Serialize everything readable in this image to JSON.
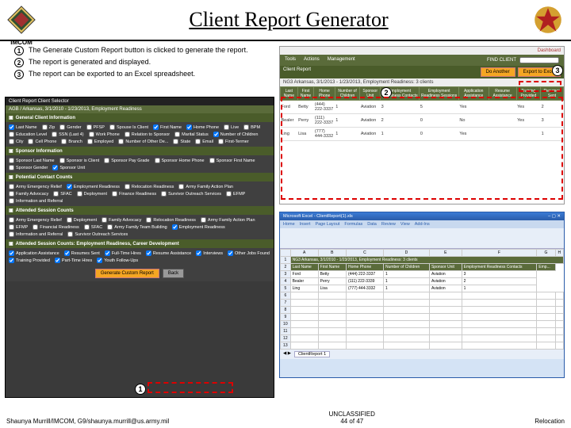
{
  "header": {
    "logo_text": "IMCOM",
    "title": "Client Report Generator"
  },
  "steps": [
    "The Generate Custom Report button is clicked to generate the report.",
    "The report is generated and displayed.",
    "The report can be exported to an Excel spreadsheet."
  ],
  "app": {
    "titlebar": "Client Report Client Selector",
    "datebar": "AGB / Arkansas, 3/1/2010 - 1/23/2013, Employment Readiness",
    "sections": {
      "gci": {
        "title": "General Client Information",
        "items": [
          "Last Name",
          "Zip",
          "Gender",
          "PFSP",
          "Spouse Is Client",
          "First Name",
          "Home Phone",
          "Live",
          "BPM",
          "Education Level",
          "SSN (Last 4)",
          "Work Phone",
          "Relation to Sponsor",
          "Marital Status",
          "Number of Children",
          "City",
          "Cell Phone",
          "Branch",
          "Employed",
          "Number of Other De...",
          "State",
          "Email",
          "First-Termer"
        ]
      },
      "si": {
        "title": "Sponsor Information",
        "items": [
          "Sponsor Last Name",
          "Sponsor is Client",
          "Sponsor Pay Grade",
          "Sponsor Home Phone",
          "Sponsor First Name",
          "Sponsor Gender",
          "Sponsor Unit"
        ]
      },
      "pcc": {
        "title": "Potential Contact Counts",
        "items": [
          "Army Emergency Relief",
          "Employment Readiness",
          "Relocation Readiness",
          "Army Family Action Plan",
          "Family Advocacy",
          "SFAC",
          "Deployment",
          "Finance Readiness",
          "Survivor Outreach Services",
          "EFMP",
          "Information and Referral"
        ]
      },
      "asc": {
        "title": "Attended Session Counts",
        "items": [
          "Army Emergency Relief",
          "Deployment",
          "Family Advocacy",
          "Relocation Readiness",
          "Army Family Action Plan",
          "EFMP",
          "Financial Readiness",
          "SFAC",
          "Army Family Team Building",
          "Employment Readiness",
          "Information and Referral",
          "Survivor Outreach Services"
        ]
      },
      "erc": {
        "title": "Attended Session Counts: Employment Readiness, Career Development",
        "items": [
          "Application Assistance",
          "Resumes Sent",
          "Full-Time Hires",
          "Resume Assistance",
          "Interviews",
          "Other Jobs Found",
          "Training Provided",
          "Part-Time Hires",
          "Youth Follow-Ups"
        ]
      }
    },
    "buttons": {
      "generate": "Generate Custom Report",
      "back": "Back"
    }
  },
  "report": {
    "dashboard": "Dashboard",
    "menu": [
      "Tools",
      "Actions",
      "Management"
    ],
    "search_label": "FIND CLIENT",
    "title": "Client Report",
    "do_another": "Do Another",
    "export": "Export to Excel",
    "subtitle": "NG3 Arkansas, 3/1/2013 - 1/23/2013, Employment Readiness:  3 clients",
    "cols": [
      "Last Name",
      "First Name",
      "Home Phone",
      "Number of Children",
      "Sponsor Unit",
      "Employment Readiness Contacts",
      "Employment Readiness Sessions",
      "Application Assistance",
      "Resume Assistance",
      "Training Provided",
      "Resumes Sent"
    ],
    "rows": [
      [
        "Ford",
        "Betty",
        "(444) 222-3337",
        "1",
        "Aviation",
        "3",
        "5",
        "Yes",
        "",
        "Yes",
        "2"
      ],
      [
        "Bealer",
        "Perry",
        "(111) 222-3337",
        "1",
        "Aviation",
        "2",
        "0",
        "No",
        "",
        "Yes",
        "3"
      ],
      [
        "Ling",
        "Lisa",
        "(777) 444-3332",
        "1",
        "Aviation",
        "1",
        "0",
        "Yes",
        "",
        "",
        "1"
      ]
    ]
  },
  "excel": {
    "title": "Microsoft Excel - ClientReport(1).xls",
    "ribbon": [
      "Home",
      "Insert",
      "Page Layout",
      "Formulas",
      "Data",
      "Review",
      "View",
      "Add-Ins"
    ],
    "cols": [
      "A",
      "B",
      "C",
      "D",
      "E",
      "F",
      "G",
      "H"
    ],
    "header_row": [
      "Last Name",
      "First Name",
      "Home Phone",
      "Number of Children",
      "Sponsor Unit",
      "Employment Readiness Contacts",
      "Emp..."
    ],
    "meta_row": "NG3 Arkansas, 3/1/2010 - 1/23/2013, Employment Readiness:  3 clients",
    "rows": [
      [
        "Ford",
        "Betty",
        "(444) 222-3337",
        "1",
        "Aviation",
        "3"
      ],
      [
        "Bealer",
        "Perry",
        "(111) 222-3339",
        "1",
        "Aviation",
        "2"
      ],
      [
        "Ling",
        "Lisa",
        "(777) 444-3332",
        "1",
        "Aviation",
        "1"
      ]
    ],
    "tab": "ClientReport 1"
  },
  "footer": {
    "left": "Shaunya Murrill/IMCOM, G9/shaunya.murrill@us.army.mil",
    "center_top": "UNCLASSIFIED",
    "center_bot": "44 of 47",
    "right": "Relocation"
  }
}
